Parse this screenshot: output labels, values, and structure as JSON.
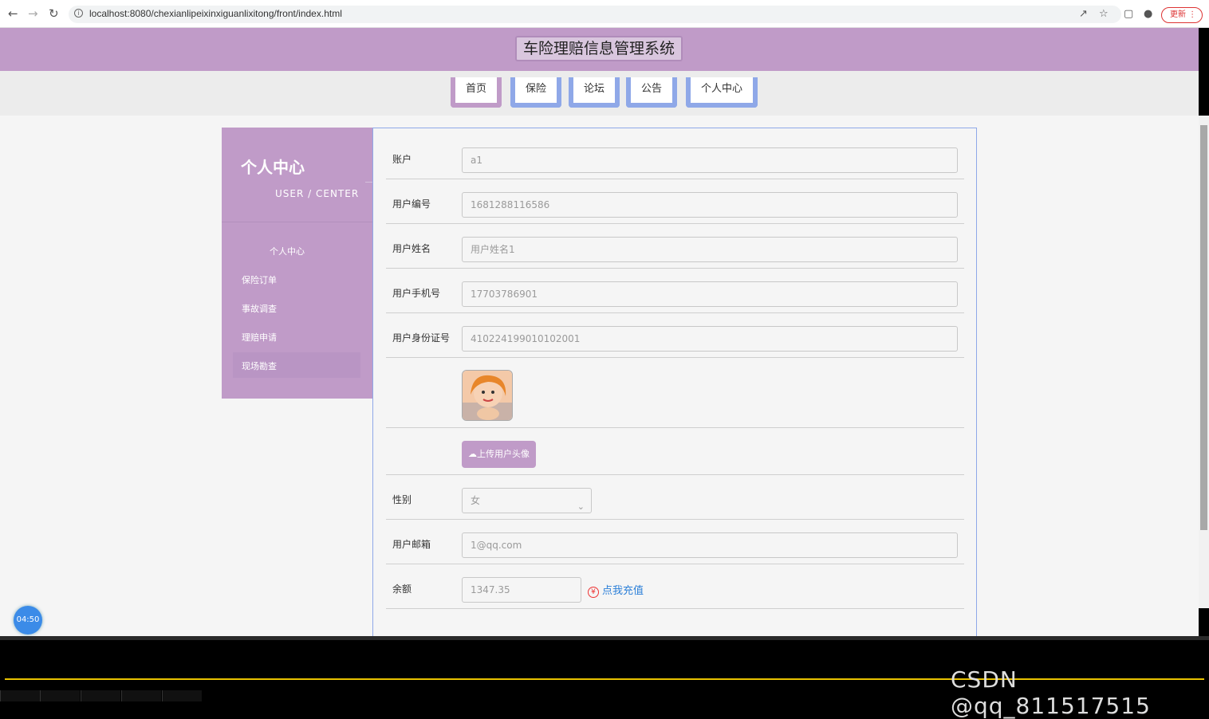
{
  "browser": {
    "url": "localhost:8080/chexianlipeixinxiguanlixitong/front/index.html",
    "update_label": "更新"
  },
  "site": {
    "title": "车险理赔信息管理系统"
  },
  "nav": {
    "items": [
      "首页",
      "保险",
      "论坛",
      "公告",
      "个人中心"
    ]
  },
  "sidebar": {
    "title": "个人中心",
    "subtitle": "USER / CENTER",
    "items": [
      "个人中心",
      "保险订单",
      "事故调查",
      "理赔申请",
      "现场勘查"
    ]
  },
  "form": {
    "account": {
      "label": "账户",
      "value": "a1"
    },
    "user_no": {
      "label": "用户编号",
      "value": "1681288116586"
    },
    "user_name": {
      "label": "用户姓名",
      "value": "用户姓名1"
    },
    "phone": {
      "label": "用户手机号",
      "value": "17703786901"
    },
    "id_card": {
      "label": "用户身份证号",
      "value": "410224199010102001"
    },
    "upload_label": "上传用户头像",
    "gender": {
      "label": "性别",
      "value": "女"
    },
    "email": {
      "label": "用户邮箱",
      "value": "1@qq.com"
    },
    "balance": {
      "label": "余额",
      "value": "1347.35",
      "recharge_label": "点我充值"
    }
  },
  "overlay": {
    "timer": "04:50",
    "watermark": "CSDN @qq_811517515"
  },
  "colors": {
    "accent": "#c09bc8",
    "nav_border": "#8fa8e8",
    "link": "#2b7fd8"
  }
}
